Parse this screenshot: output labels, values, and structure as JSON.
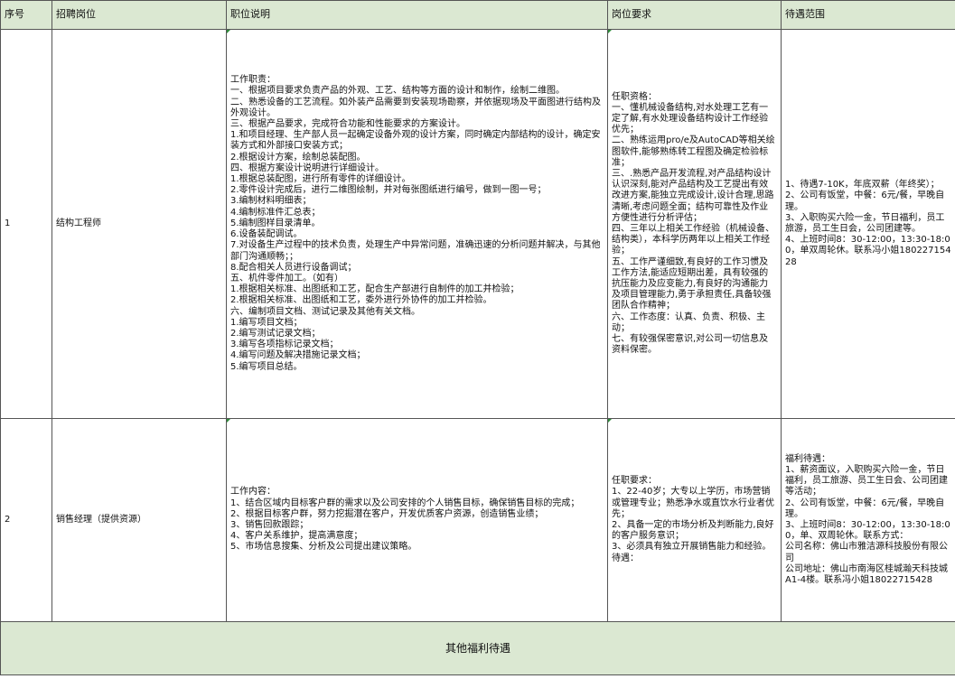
{
  "headers": [
    "序号",
    "招聘岗位",
    "职位说明",
    "岗位要求",
    "待遇范围"
  ],
  "rows": [
    {
      "no": "1",
      "title": "结构工程师",
      "description": "工作职责：\n一、根据项目要求负责产品的外观、工艺、结构等方面的设计和制作，绘制二维图。\n二、熟悉设备的工艺流程。如外装产品需要到安装现场勘察，并依据现场及平面图进行结构及外观设计。\n三、根据产品要求，完成符合功能和性能要求的方案设计。\n1.和项目经理、生产部人员一起确定设备外观的设计方案，同时确定内部结构的设计，确定安装方式和外部接口安装方式；\n2.根据设计方案，绘制总装配图。\n四、根据方案设计说明进行详细设计。\n1.根据总装配图，进行所有零件的详细设计。\n2.零件设计完成后，进行二维图绘制，并对每张图纸进行编号，做到一图一号；\n3.编制材料明细表；\n4.编制标准件汇总表；\n5.编制图样目录清单。\n6.设备装配调试。\n7.对设备生产过程中的技术负责，处理生产中异常问题，准确迅速的分析问题并解决，与其他部门沟通顺畅；；\n8.配合相关人员进行设备调试；\n五、机件零件加工。（如有）\n1.根据相关标准、出图纸和工艺，配合生产部进行自制件的加工并检验；\n2.根据相关标准、出图纸和工艺，委外进行外协件的加工并检验。\n六、编制项目文档、测试记录及其他有关文档。\n1.编写项目文档；\n2.编写测试记录文档；\n3.编写各项指标记录文档；\n4.编写问题及解决措施记录文档；\n5.编写项目总结。",
      "requirements": "任职资格：\n一、懂机械设备结构,对水处理工艺有一定了解,有水处理设备结构设计工作经验优先；\n二、熟练运用pro/e及AutoCAD等相关绘图软件,能够熟练转工程图及确定检验标准；\n三、.熟悉产品开发流程,对产品结构设计认识深刻,能对产品结构及工艺提出有效改进方案,能独立完成设计,设计合理,思路清晰,考虑问题全面；结构可靠性及作业方便性进行分析评估；\n四、三年以上相关工作经验（机械设备、结构类），本科学历两年以上相关工作经验；\n五、工作严谨细致,有良好的工作习惯及工作方法,能适应短期出差，具有较强的抗压能力及应变能力,有良好的沟通能力及项目管理能力,勇于承担责任,具备较强团队合作精神；\n六、工作态度：认真、负责、积极、主动；\n七、有较强保密意识,对公司一切信息及资料保密。",
      "benefits": "1、待遇7-10K，年底双薪（年终奖）；\n2、公司有饭堂，中餐：6元/餐，早晚自理。\n3、入职购买六险一金，节日福利，员工旅游，员工生日会，公司团建等。\n4、上班时间8：30-12:00，13:30-18:00，单双周轮休。联系冯小姐18022715428"
    },
    {
      "no": "2",
      "title": "销售经理（提供资源）",
      "description": "工作内容：\n1、结合区域内目标客户群的需求以及公司安排的个人销售目标，确保销售目标的完成；\n2、根据目标客户群，努力挖掘潜在客户，开发优质客户资源，创造销售业绩；\n3、销售回款跟踪；\n4、客户关系维护，提高满意度；\n5、市场信息搜集、分析及公司提出建议策略。",
      "requirements": "任职要求：\n1、22-40岁；大专以上学历，市场营销或管理专业；熟悉净水或直饮水行业者优先；\n2、具备一定的市场分析及判断能力,良好的客户服务意识；\n3、必须具有独立开展销售能力和经验。\n待遇：",
      "benefits": "福利待遇：\n1、薪资面议，入职购买六险一金，节日福利，员工旅游、员工生日会、公司团建等活动；\n2、公司有饭堂，中餐：6元/餐，早晚自理。\n3、上班时间8：30-12:00，13:30-18:00，单、双周轮休。联系方式：\n公司名称：佛山市雅洁源科技股份有限公司\n公司地址：佛山市南海区桂城瀚天科技城A1-4楼。联系冯小姐18022715428"
    }
  ],
  "footer": "其他福利待遇",
  "colors": {
    "header_bg": "#dbe8d2",
    "border": "#555555",
    "marker": "#2e8b3a"
  }
}
